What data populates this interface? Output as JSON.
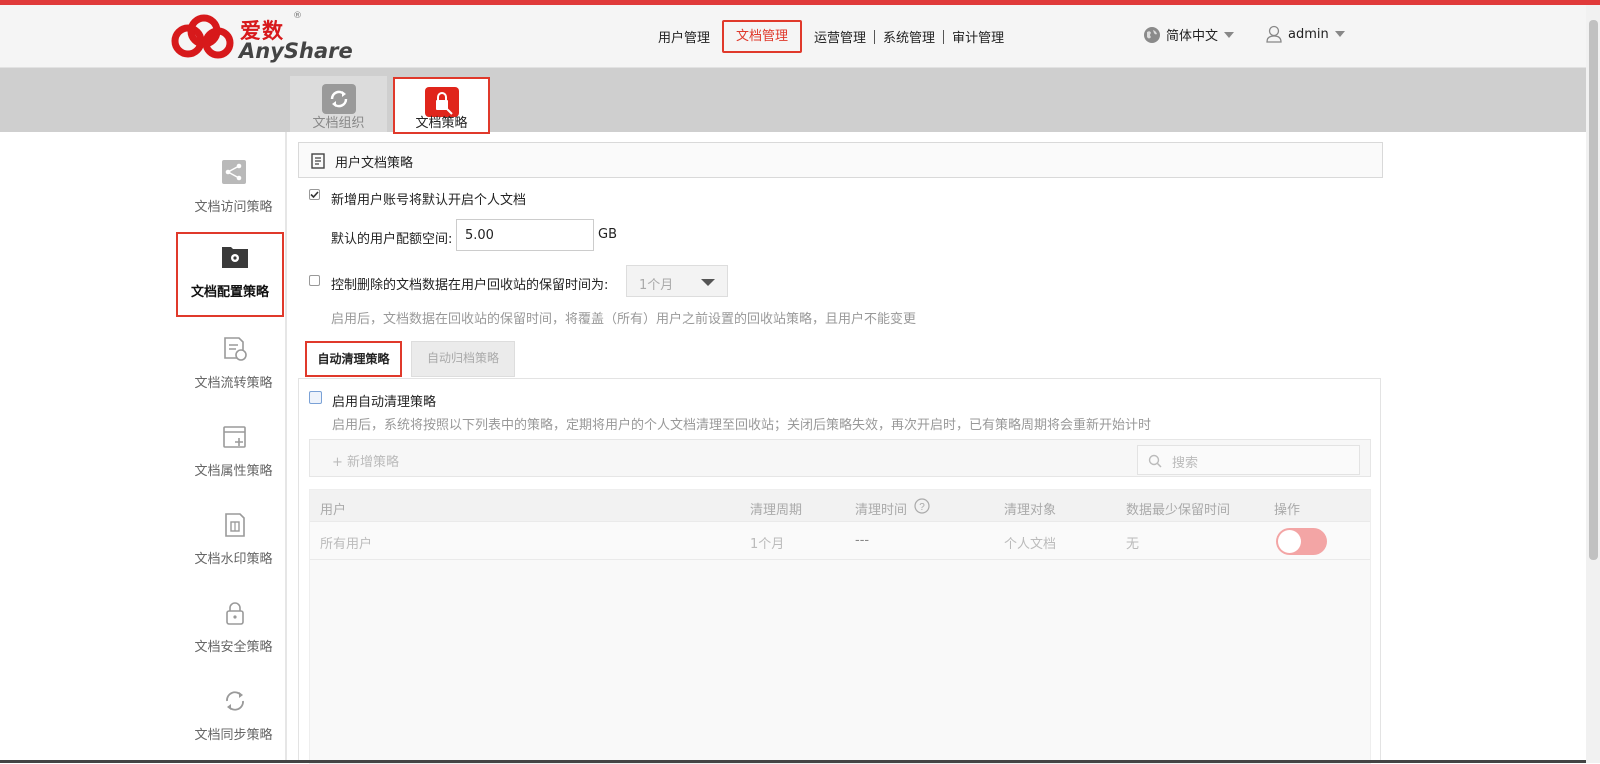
{
  "header": {
    "logo_cn": "爱数",
    "logo_reg": "®",
    "logo_en": "AnyShare",
    "nav": [
      {
        "label": "用户管理",
        "active": false
      },
      {
        "label": "文档管理",
        "active": true
      },
      {
        "label": "运营管理",
        "active": false
      },
      {
        "label": "系统管理",
        "active": false
      },
      {
        "label": "审计管理",
        "active": false
      }
    ],
    "language": "简体中文",
    "username": "admin"
  },
  "subtabs": [
    {
      "label": "文档组织",
      "icon": "refresh-icon",
      "active": false
    },
    {
      "label": "文档策略",
      "icon": "lock-doc-icon",
      "active": true
    }
  ],
  "sidebar": {
    "items": [
      {
        "label": "文档访问策略",
        "icon": "share-nodes-icon",
        "active": false
      },
      {
        "label": "文档配置策略",
        "icon": "folder-gear-icon",
        "active": true
      },
      {
        "label": "文档流转策略",
        "icon": "doc-flow-icon",
        "active": false
      },
      {
        "label": "文档属性策略",
        "icon": "doc-attribute-icon",
        "active": false
      },
      {
        "label": "文档水印策略",
        "icon": "watermark-icon",
        "active": false
      },
      {
        "label": "文档安全策略",
        "icon": "padlock-icon",
        "active": false
      },
      {
        "label": "文档同步策略",
        "icon": "sync-icon",
        "active": false
      }
    ]
  },
  "main": {
    "section_title": "用户文档策略",
    "personal_doc_checkbox_label": "新增用户账号将默认开启个人文档",
    "personal_doc_checked": true,
    "quota_label": "默认的用户配额空间:",
    "quota_value": "5.00",
    "quota_unit": "GB",
    "recycle_checkbox_label": "控制删除的文档数据在用户回收站的保留时间为:",
    "recycle_checked": false,
    "recycle_select_value": "1个月",
    "recycle_hint": "启用后，文档数据在回收站的保留时间，将覆盖（所有）用户之前设置的回收站策略，且用户不能变更",
    "policy_tabs": [
      {
        "label": "自动清理策略",
        "active": true
      },
      {
        "label": "自动归档策略",
        "active": false
      }
    ],
    "auto_clean": {
      "enable_label": "启用自动清理策略",
      "enabled": false,
      "hint": "启用后，系统将按照以下列表中的策略，定期将用户的个人文档清理至回收站；关闭后策略失效，再次开启时，已有策略周期将会重新开始计时",
      "add_button": "+ 新增策略",
      "search_placeholder": "搜索",
      "columns": [
        "用户",
        "清理周期",
        "清理时间",
        "清理对象",
        "数据最少保留时间",
        "操作"
      ],
      "rows": [
        {
          "user": "所有用户",
          "period": "1个月",
          "time": "---",
          "target": "个人文档",
          "min_keep": "无",
          "enabled": false
        }
      ]
    }
  },
  "colors": {
    "accent": "#e0392b",
    "toggle_off": "#f3a5a5",
    "brand_red": "#d7191b"
  }
}
